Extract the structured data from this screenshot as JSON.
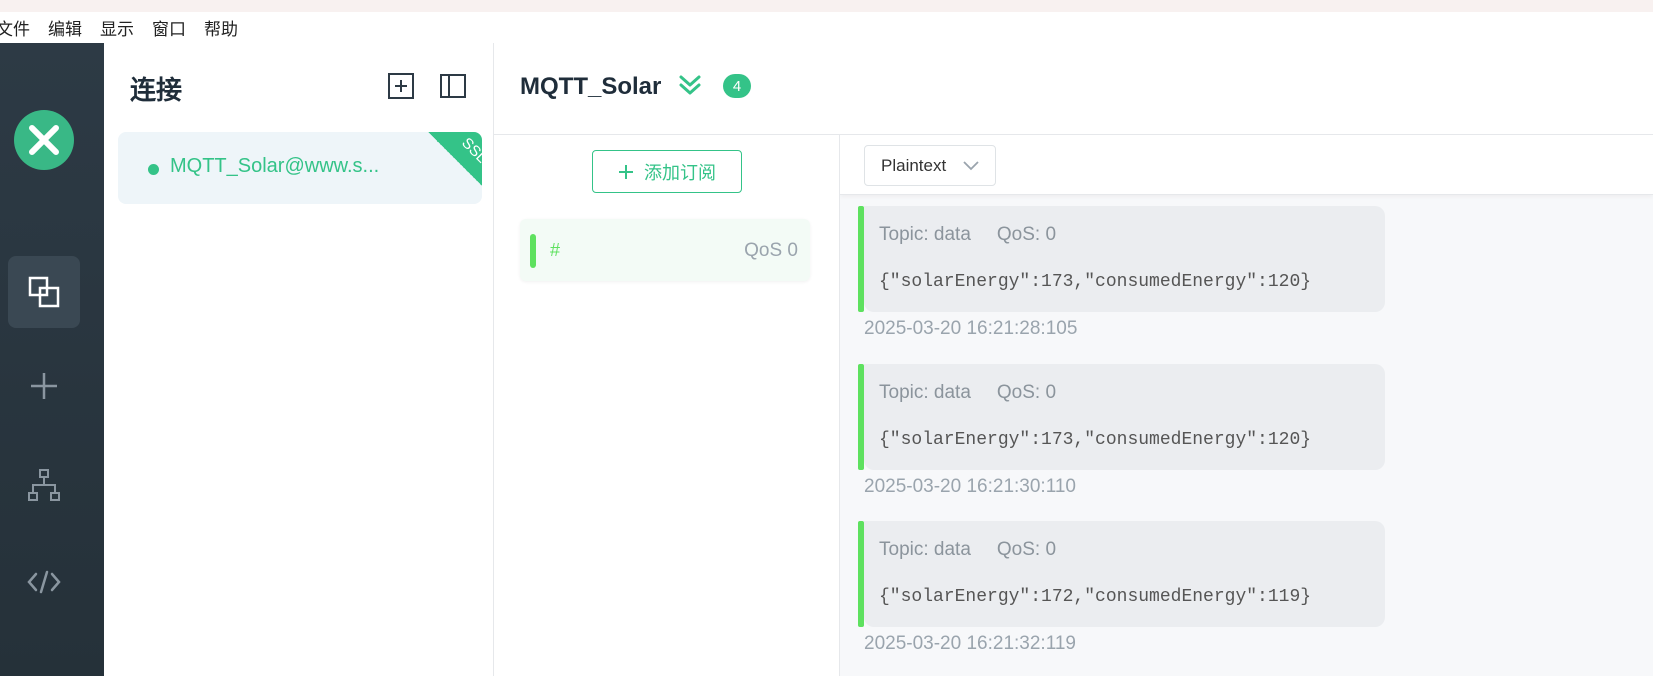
{
  "menu": [
    "文件",
    "编辑",
    "显示",
    "窗口",
    "帮助"
  ],
  "sidebar": {
    "nav": [
      "connections-icon",
      "plus-icon",
      "topology-icon",
      "code-icon"
    ]
  },
  "connections": {
    "title": "连接",
    "items": [
      {
        "name": "MQTT_Solar@www.s...",
        "badge": "SSL",
        "status_color": "#34c388"
      }
    ]
  },
  "header": {
    "title": "MQTT_Solar",
    "count": "4"
  },
  "subscriptions": {
    "add_label": "添加订阅",
    "items": [
      {
        "topic": "#",
        "qos": "QoS 0",
        "color": "#5ee15f"
      }
    ]
  },
  "messages": {
    "format": "Plaintext",
    "items": [
      {
        "topic": "Topic: data",
        "qos": "QoS: 0",
        "payload": "{\"solarEnergy\":173,\"consumedEnergy\":120}",
        "time": "2025-03-20 16:21:28:105"
      },
      {
        "topic": "Topic: data",
        "qos": "QoS: 0",
        "payload": "{\"solarEnergy\":173,\"consumedEnergy\":120}",
        "time": "2025-03-20 16:21:30:110"
      },
      {
        "topic": "Topic: data",
        "qos": "QoS: 0",
        "payload": "{\"solarEnergy\":172,\"consumedEnergy\":119}",
        "time": "2025-03-20 16:21:32:119"
      }
    ]
  },
  "colors": {
    "accent": "#34c388",
    "message_bar": "#5ee15f",
    "sidebar_bg": "#2b3741"
  }
}
